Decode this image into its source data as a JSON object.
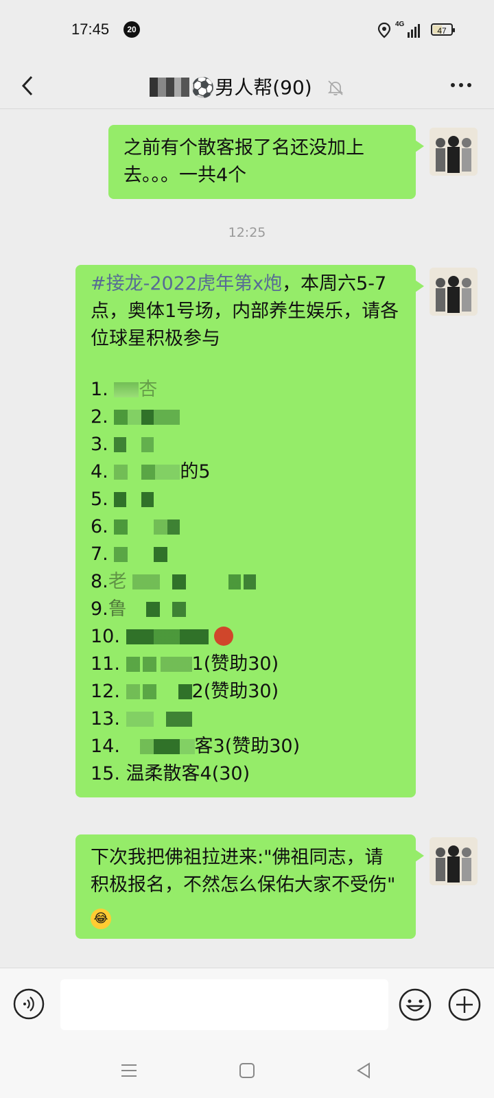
{
  "status_bar": {
    "time": "17:45",
    "notification_count": "20",
    "network": "4G",
    "battery": "47"
  },
  "nav": {
    "title": "⚽男人帮(90)"
  },
  "messages": [
    {
      "text": "之前有个散客报了名还没加上去。。。一共4个"
    },
    {
      "timestamp": "12:25"
    },
    {
      "hashtag": "#接龙-2022虎年第x炮",
      "text": "，本周六5-7点，奥体1号场，内部养生娱乐，请各位球星积极参与",
      "entries": [
        {
          "num": "1.",
          "visible": "杏"
        },
        {
          "num": "2.",
          "visible": ""
        },
        {
          "num": "3.",
          "visible": ""
        },
        {
          "num": "4.",
          "visible": "的5"
        },
        {
          "num": "5.",
          "visible": ""
        },
        {
          "num": "6.",
          "visible": ""
        },
        {
          "num": "7.",
          "visible": ""
        },
        {
          "num": "8.",
          "visible": "老"
        },
        {
          "num": "9.",
          "visible": "鲁"
        },
        {
          "num": "10.",
          "visible": ""
        },
        {
          "num": "11.",
          "visible": "1(赞助30)"
        },
        {
          "num": "12.",
          "visible": "2(赞助30)"
        },
        {
          "num": "13.",
          "visible": ""
        },
        {
          "num": "14.",
          "visible": "客3(赞助30)"
        },
        {
          "num": "15.",
          "visible": "温柔散客4(30)"
        }
      ]
    },
    {
      "text": "下次我把佛祖拉进来:\"佛祖同志，请积极报名，不然怎么保佑大家不受伤\"",
      "emoji": "😂"
    }
  ],
  "colors": {
    "bubble": "#95ec69",
    "hashtag": "#576b95",
    "background": "#ededed"
  }
}
